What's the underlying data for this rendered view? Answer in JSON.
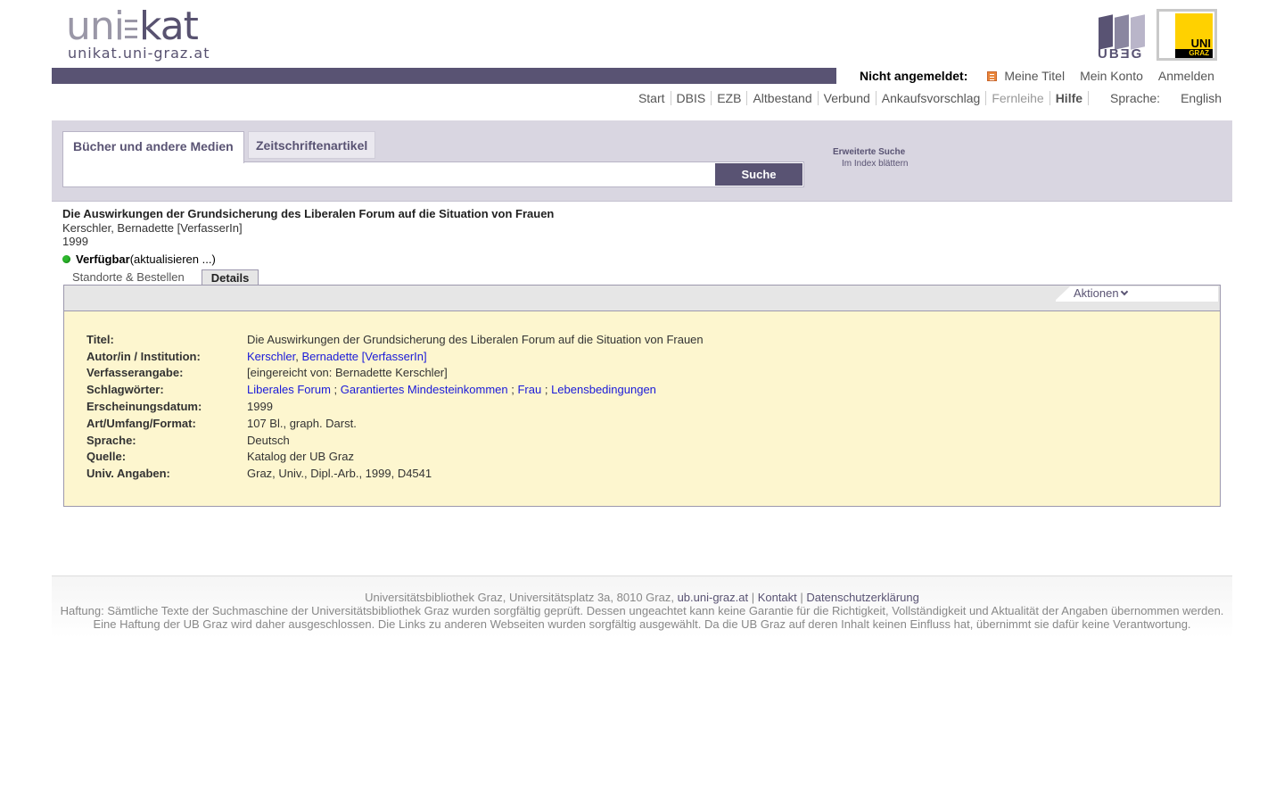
{
  "logo": {
    "uni": "uni",
    "kat": "kat",
    "subtitle": "unikat.uni-graz.at",
    "ub_text": "UBƎG",
    "unigraz_top": "UNI",
    "unigraz_bottom": "GRAZ"
  },
  "user_bar": {
    "status_label": "Nicht angemeldet:",
    "my_titles": "Meine Titel",
    "my_account": "Mein Konto",
    "login": "Anmelden"
  },
  "topnav": {
    "items": [
      "Start",
      "DBIS",
      "EZB",
      "Altbestand",
      "Verbund",
      "Ankaufsvorschlag",
      "Fernleihe",
      "Hilfe"
    ],
    "language_label": "Sprache:",
    "language_link": "English"
  },
  "search": {
    "tab_books": "Bücher und andere Medien",
    "tab_articles": "Zeitschriftenartikel",
    "input_value": "",
    "button": "Suche",
    "advanced": "Erweiterte Suche",
    "index_browse": "Im Index blättern"
  },
  "record": {
    "title": "Die Auswirkungen der Grundsicherung des Liberalen Forum auf die Situation von Frauen",
    "author": "Kerschler, Bernadette [VerfasserIn]",
    "year": "1999",
    "availability": "Verfügbar",
    "refresh": "(aktualisieren ...)",
    "tab_locations": "Standorte & Bestellen",
    "tab_details": "Details",
    "actions": "Aktionen"
  },
  "details": {
    "title_label": "Titel:",
    "title_value": "Die Auswirkungen der Grundsicherung des Liberalen Forum auf die Situation von Frauen",
    "author_label": "Autor/in / Institution:",
    "author_last": "Kerschler",
    "author_rest": "Bernadette [VerfasserIn]",
    "statement_label": "Verfasserangabe:",
    "statement_value": "[eingereicht von: Bernadette Kerschler]",
    "subjects_label": "Schlagwörter:",
    "subjects": [
      "Liberales Forum",
      "Garantiertes Mindesteinkommen",
      "Frau",
      "Lebensbedingungen"
    ],
    "date_label": "Erscheinungsdatum:",
    "date_value": "1999",
    "format_label": "Art/Umfang/Format:",
    "format_value": "107 Bl., graph. Darst.",
    "language_label": "Sprache:",
    "language_value": "Deutsch",
    "source_label": "Quelle:",
    "source_value": "Katalog der UB Graz",
    "univ_label": "Univ. Angaben:",
    "univ_value": "Graz, Univ., Dipl.-Arb., 1999, D4541"
  },
  "footer": {
    "address": "Universitätsbibliothek Graz, Universitätsplatz 3a, 8010 Graz,",
    "link_site": "ub.uni-graz.at",
    "link_contact": "Kontakt",
    "link_privacy": "Datenschutzerklärung",
    "disclaimer1": "Haftung: Sämtliche Texte der Suchmaschine der Universitätsbibliothek Graz wurden sorgfältig geprüft. Dessen ungeachtet kann keine Garantie für die Richtigkeit, Vollständigkeit und Aktualität der Angaben übernommen werden.",
    "disclaimer2": "Eine Haftung der UB Graz wird daher ausgeschlossen. Die Links zu anderen Webseiten wurden sorgfältig ausgewählt. Da die UB Graz auf deren Inhalt keinen Einfluss hat, übernimmt sie dafür keine Verantwortung."
  },
  "colors": {
    "brand_purple": "#595373",
    "details_bg": "#fdf6cf",
    "link_blue": "#1a1ad9",
    "available_green": "#2db82d"
  }
}
